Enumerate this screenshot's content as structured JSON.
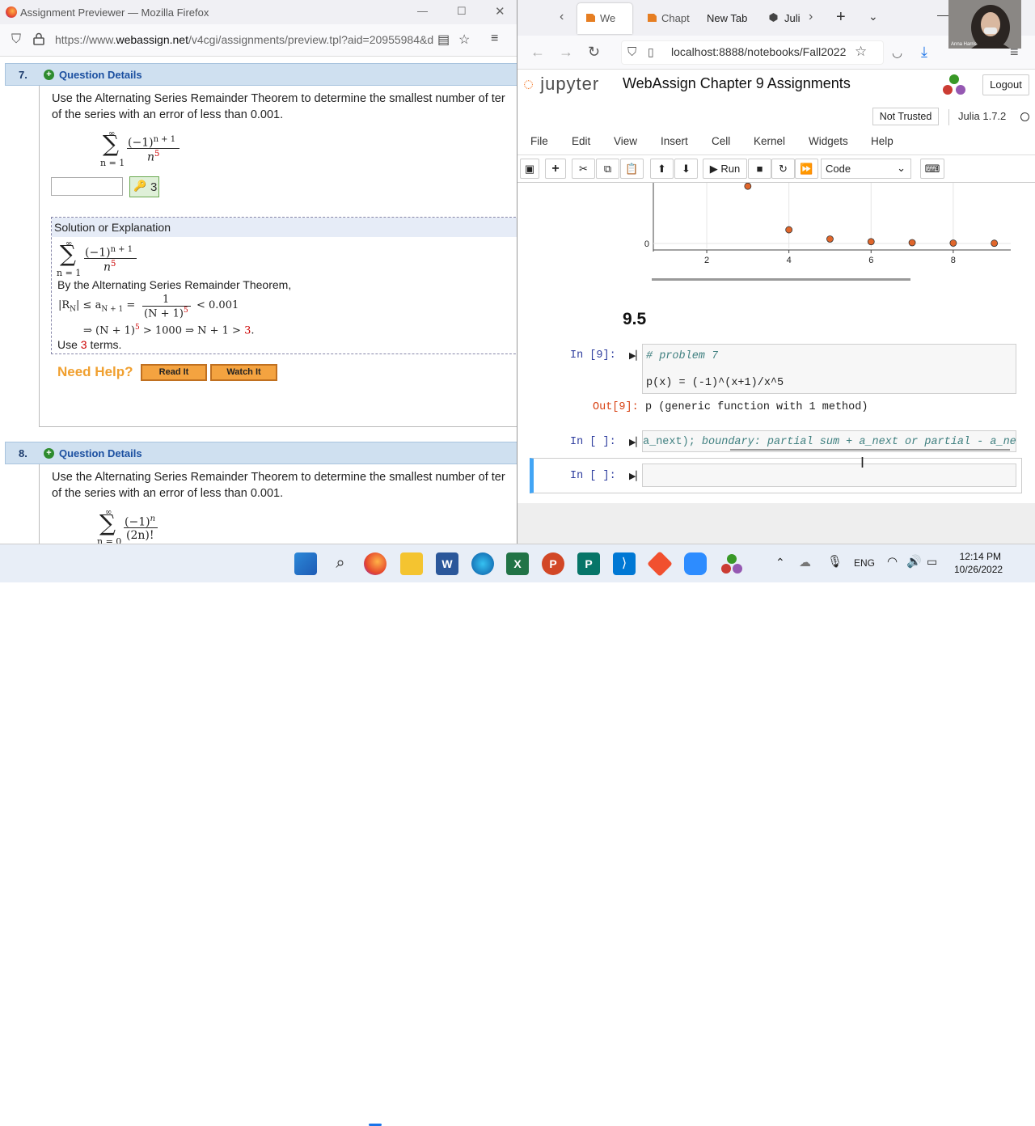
{
  "left_window": {
    "title": "Assignment Previewer — Mozilla Firefox",
    "url_prefix": "https://www.",
    "url_domain": "webassign.net",
    "url_rest": "/v4cgi/assignments/preview.tpl?aid=20955984&d",
    "q7": {
      "number": "7.",
      "details_label": "Question Details",
      "text_line1": "Use the Alternating Series Remainder Theorem to determine the smallest number of ter",
      "text_line2": "of the series with an error of less than 0.001.",
      "sum_top": "∞",
      "sum_sym": "∑",
      "sum_bottom": "n = 1",
      "numerator": "(−1)",
      "num_exp": "n + 1",
      "denominator": "n",
      "den_exp": "5",
      "answer_value": "",
      "key_answer": "3",
      "solution_header": "Solution or Explanation",
      "sol_text1": "By the Alternating Series Remainder Theorem,",
      "sol_ineq_left": "|R",
      "sol_ineq_sub": "N",
      "sol_ineq_mid": "| ≤ a",
      "sol_ineq_sub2": "N + 1",
      "sol_ineq_eq": "=",
      "sol_frac_num": "1",
      "sol_frac_den": "(N + 1)",
      "sol_frac_exp": "5",
      "sol_ineq_right": "< 0.001",
      "sol_impl_1": "⇒ (N + 1)",
      "sol_impl_exp": "5",
      "sol_impl_2": " > 1000 ⇒ N + 1 > ",
      "sol_impl_red": "3",
      "sol_impl_end": ".",
      "use_prefix": "Use ",
      "use_red": "3",
      "use_suffix": " terms.",
      "need_help": "Need Help?",
      "read_it": "Read It",
      "watch_it": "Watch It"
    },
    "q8": {
      "number": "8.",
      "details_label": "Question Details",
      "text_line1": "Use the Alternating Series Remainder Theorem to determine the smallest number of ter",
      "text_line2": "of the series with an error of less than 0.001.",
      "sum_top": "∞",
      "sum_sym": "∑",
      "sum_bottom": "n = 0",
      "numerator": "(−1)",
      "num_exp": "n",
      "denominator": "(2n)!"
    }
  },
  "right_window": {
    "tabs": [
      {
        "label": "We"
      },
      {
        "label": "Chapt"
      },
      {
        "label": "New Tab"
      },
      {
        "label": "Juli"
      }
    ],
    "url": "localhost:8888/notebooks/Fall2022",
    "logo_text_pre": "",
    "logo_text": "jupyter",
    "notebook_title": "WebAssign Chapter 9 Assignments",
    "logout": "Logout",
    "not_trusted": "Not Trusted",
    "kernel_name": "Julia 1.7.2",
    "menu": [
      "File",
      "Edit",
      "View",
      "Insert",
      "Cell",
      "Kernel",
      "Widgets",
      "Help"
    ],
    "run_label": "Run",
    "cell_type": "Code",
    "heading": "9.5",
    "cell9_prompt": "In [9]:",
    "cell9_comment": "# problem 7",
    "cell9_code": "p(x) = (-1)^(x+1)/x^5",
    "out9_prompt": "Out[9]:",
    "out9_text": "p (generic function with 1 method)",
    "cellA_prompt": "In [ ]:",
    "cellA_code_pre": "a_next);",
    "cellA_comment": "  boundary: partial sum + a_next or partial - a_next",
    "cellB_prompt": "In [ ]:"
  },
  "chart_data": {
    "type": "scatter",
    "x": [
      3,
      4,
      5,
      6,
      7,
      8,
      9
    ],
    "y": [
      0.0041,
      0.00098,
      0.00032,
      0.00013,
      6e-05,
      3e-05,
      1.7e-05
    ],
    "x_ticks": [
      "2",
      "4",
      "6",
      "8"
    ],
    "y_ticks": [
      "0"
    ],
    "marker_color": "#e0662b",
    "grid": true
  },
  "webcam_label": "Anna Harris",
  "taskbar": {
    "lang": "ENG",
    "time": "12:14 PM",
    "date": "10/26/2022"
  }
}
